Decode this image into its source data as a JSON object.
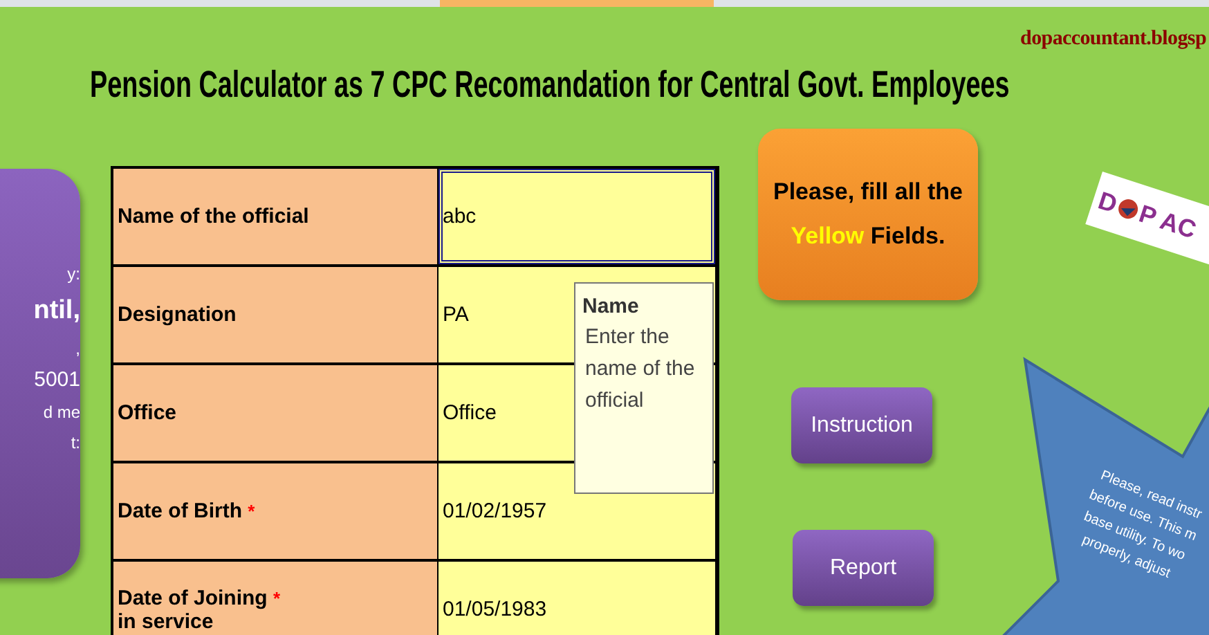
{
  "blog_url": "dopaccountant.blogsp",
  "title": "Pension Calculator as 7 CPC Recomandation for Central Govt. Employees",
  "side_panel": {
    "lines": [
      {
        "text": "y:",
        "kind": "small"
      },
      {
        "text": "ntil,",
        "kind": "big"
      },
      {
        "text": ",",
        "kind": "small"
      },
      {
        "text": "5001",
        "kind": "mid"
      },
      {
        "text": "d me",
        "kind": "small"
      },
      {
        "text": "t:",
        "kind": "small"
      }
    ]
  },
  "form": {
    "rows": [
      {
        "label": "Name of the official",
        "value": "abc",
        "selected": true
      },
      {
        "label": "Designation",
        "value": "PA",
        "selected": false
      },
      {
        "label": "Office",
        "value": "Office",
        "selected": false
      },
      {
        "label": "Date of Birth",
        "marker": "*",
        "value": "01/02/1957",
        "selected": false
      },
      {
        "label": "Date of Joining",
        "marker": "*",
        "label_2": "in service",
        "value": "01/05/1983",
        "selected": false
      }
    ]
  },
  "tooltip": {
    "title": "Name",
    "text": "Enter the name of the official"
  },
  "notice": {
    "before": "Please, fill all the",
    "highlight": "Yellow",
    "after": "Fields."
  },
  "buttons": [
    "Instruction",
    "Report"
  ],
  "logo": {
    "left": "D",
    "right": "P AC"
  },
  "starburst": {
    "lines": [
      "Please, read instr",
      "before use. This m",
      "base utility. To wo",
      "properly, adjust"
    ]
  }
}
